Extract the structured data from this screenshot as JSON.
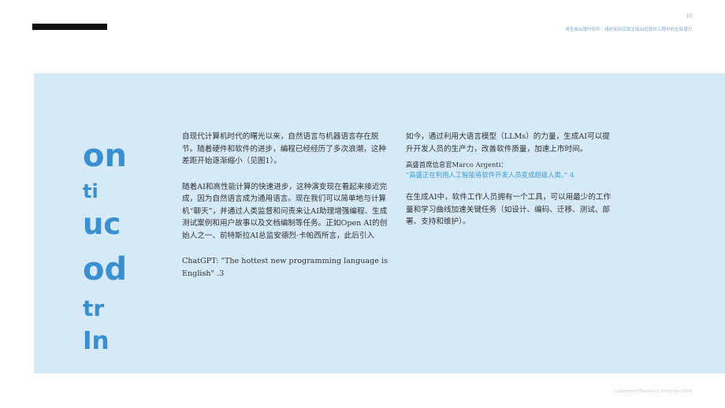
{
  "page_number": "10",
  "header": {
    "title": "用生成AI提升软件：组织如何实现生成AI在软件工程中的全部潜力"
  },
  "vertical_title": [
    "on",
    "ti",
    "uc",
    "od",
    "tr",
    "In"
  ],
  "left_column": {
    "para1": "自现代计算机时代的曙光以来，自然语言与机器语言存在脱节。随着硬件和软件的进步，编程已经经历了多次浪潮，这种差距开始逐渐缩小（见图1）。",
    "para2": "随着AI和高性能计算的快速进步，这种演变现在看起来接近完成，因为自然语言成为通用语言。现在我们可以简单地与计算机“聊天”，并通过人类监督和问责来让AI助理增强编程、生成测试案例和用户故事以及文档编制等任务。正如Open AI的创始人之一、前特斯拉AI总监安德烈·卡帕西所言，此后引入",
    "para3": "ChatGPT: \"The hottest new programming language is English\" .3"
  },
  "right_column": {
    "para1": "如今，通过利用大语言模型（LLMs）的力量，生成AI可以提升开发人员的生产力，改善软件质量，加速上市时间。",
    "quote_attribution": "高盛首席信息官Marco Argenti：",
    "quote_text": "“高盛正在利用人工智能将软件开发人员变成超级人类。” 4",
    "para2": "在生成AI中，软件工作人员拥有一个工具，可以用最少的工作量和学习曲线加速关键任务（如设计、编码、迁移、测试、部署、支持和维护）。"
  },
  "footer": {
    "text": "Capgemini Research Institute 2024"
  }
}
